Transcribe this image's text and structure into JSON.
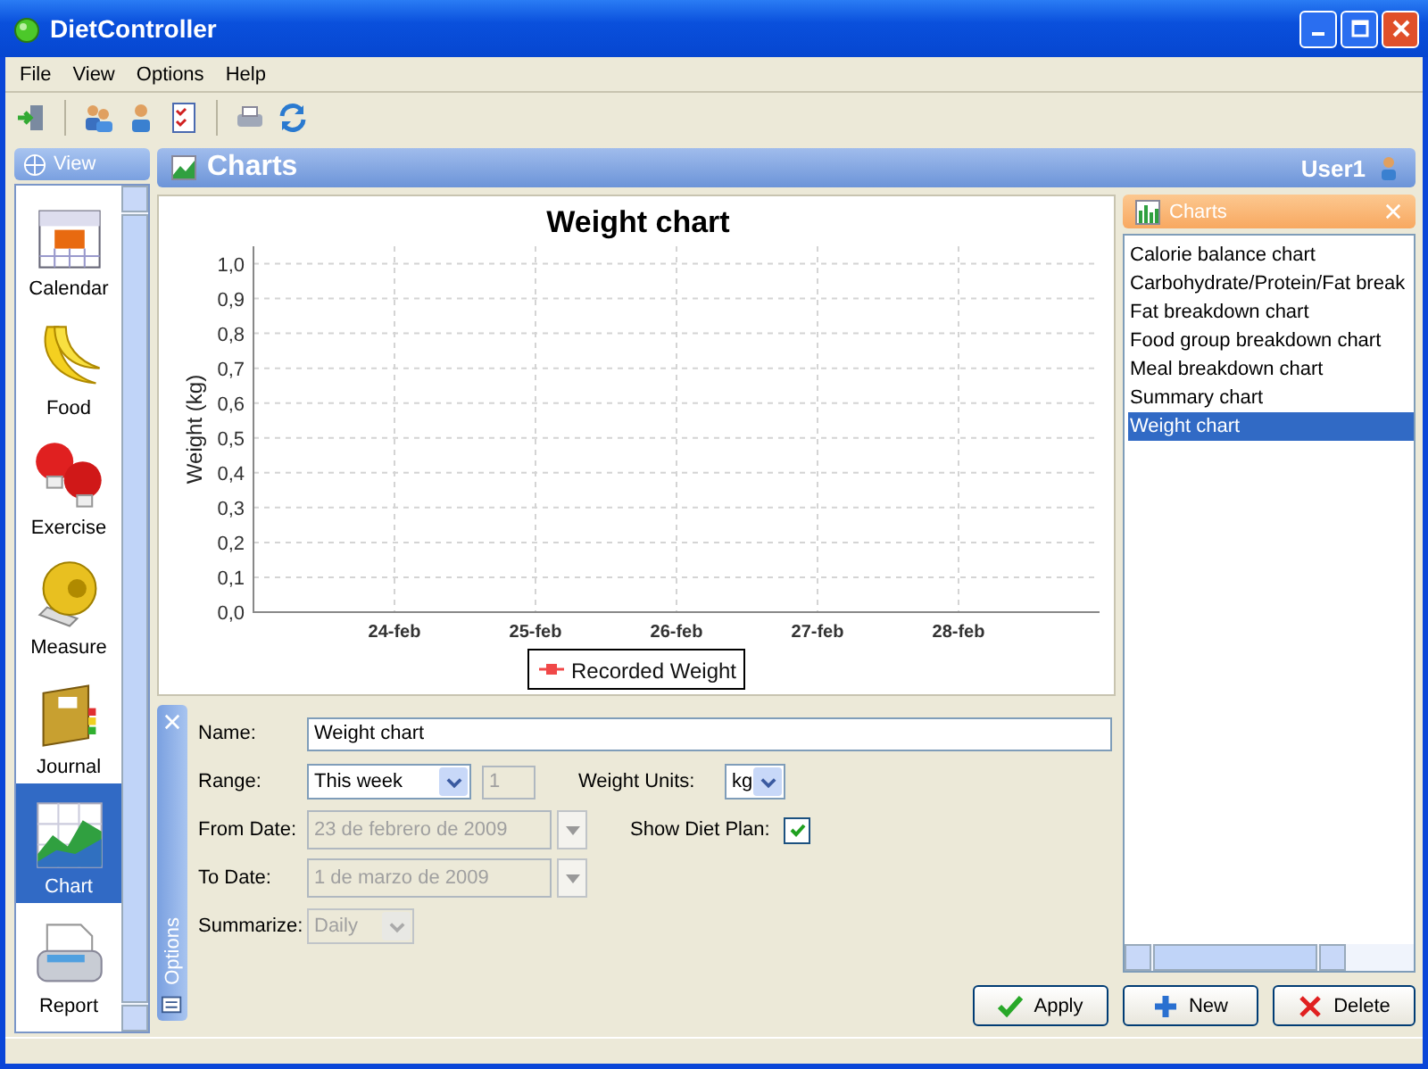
{
  "window": {
    "title": "DietController"
  },
  "menu": [
    "File",
    "View",
    "Options",
    "Help"
  ],
  "sidebar": {
    "header": "View",
    "items": [
      {
        "label": "Calendar",
        "kind": "calendar",
        "selected": false
      },
      {
        "label": "Food",
        "kind": "food",
        "selected": false
      },
      {
        "label": "Exercise",
        "kind": "exercise",
        "selected": false
      },
      {
        "label": "Measure",
        "kind": "measure",
        "selected": false
      },
      {
        "label": "Journal",
        "kind": "journal",
        "selected": false
      },
      {
        "label": "Chart",
        "kind": "chart",
        "selected": true
      },
      {
        "label": "Report",
        "kind": "report",
        "selected": false
      }
    ]
  },
  "header": {
    "title": "Charts",
    "user": "User1"
  },
  "chart": {
    "chart_data": {
      "type": "line",
      "title": "Weight chart",
      "ylabel": "Weight (kg)",
      "categories": [
        "24-feb",
        "25-feb",
        "26-feb",
        "27-feb",
        "28-feb"
      ],
      "ylim": [
        0,
        1.05
      ],
      "grid": true,
      "yticks": [
        {
          "value": 0,
          "label": "0,0"
        },
        {
          "value": 0.1,
          "label": "0,1"
        },
        {
          "value": 0.2,
          "label": "0,2"
        },
        {
          "value": 0.3,
          "label": "0,3"
        },
        {
          "value": 0.4,
          "label": "0,4"
        },
        {
          "value": 0.5,
          "label": "0,5"
        },
        {
          "value": 0.6,
          "label": "0,6"
        },
        {
          "value": 0.7,
          "label": "0,7"
        },
        {
          "value": 0.8,
          "label": "0,8"
        },
        {
          "value": 0.9,
          "label": "0,9"
        },
        {
          "value": 1.0,
          "label": "1,0"
        }
      ],
      "series": [
        {
          "name": "Recorded Weight",
          "color": "#f04848",
          "values": [
            null,
            null,
            null,
            null,
            null
          ]
        }
      ]
    }
  },
  "options": {
    "tab_label": "Options",
    "name": {
      "label": "Name:",
      "value": "Weight chart"
    },
    "range": {
      "label": "Range:",
      "value": "This week",
      "count": "1",
      "count_disabled": true
    },
    "from_date": {
      "label": "From Date:",
      "value": "23 de febrero de 2009",
      "disabled": true
    },
    "to_date": {
      "label": "To Date:",
      "value": "1 de marzo de 2009",
      "disabled": true
    },
    "summarize": {
      "label": "Summarize:",
      "value": "Daily",
      "disabled": true
    },
    "weight_units": {
      "label": "Weight Units:",
      "value": "kg"
    },
    "show_diet_plan": {
      "label": "Show Diet Plan:",
      "checked": true
    }
  },
  "charts_panel": {
    "title": "Charts",
    "items": [
      {
        "label": "Calorie balance chart",
        "selected": false
      },
      {
        "label": "Carbohydrate/Protein/Fat break",
        "selected": false
      },
      {
        "label": "Fat breakdown chart",
        "selected": false
      },
      {
        "label": "Food group breakdown chart",
        "selected": false
      },
      {
        "label": "Meal breakdown chart",
        "selected": false
      },
      {
        "label": "Summary chart",
        "selected": false
      },
      {
        "label": "Weight chart",
        "selected": true
      }
    ]
  },
  "buttons": [
    {
      "label": "Apply",
      "kind": "apply"
    },
    {
      "label": "New",
      "kind": "new"
    },
    {
      "label": "Delete",
      "kind": "delete"
    }
  ]
}
